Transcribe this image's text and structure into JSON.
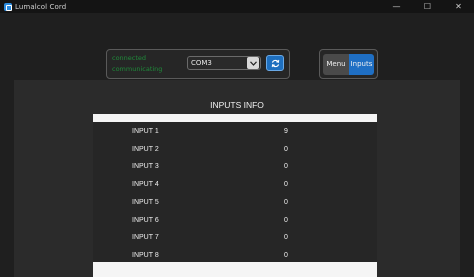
{
  "window": {
    "title": "Lumalcol Cord",
    "controls": {
      "minimize": "—",
      "maximize": "☐",
      "close": "✕"
    }
  },
  "connection": {
    "status_line_1": "connected",
    "status_line_2": "communicating",
    "port_value": "COM3",
    "dropdown_icon": "chevron-down-icon",
    "refresh_icon": "refresh-icon"
  },
  "nav": {
    "menu_label": "Menu",
    "inputs_label": "Inputs",
    "active": "Inputs"
  },
  "inputs_info": {
    "title": "INPUTS INFO",
    "rows": [
      {
        "name": "INPUT 1",
        "value": "9"
      },
      {
        "name": "INPUT 2",
        "value": "0"
      },
      {
        "name": "INPUT 3",
        "value": "0"
      },
      {
        "name": "INPUT 4",
        "value": "0"
      },
      {
        "name": "INPUT 5",
        "value": "0"
      },
      {
        "name": "INPUT 6",
        "value": "0"
      },
      {
        "name": "INPUT 7",
        "value": "0"
      },
      {
        "name": "INPUT 8",
        "value": "0"
      }
    ]
  },
  "colors": {
    "accent": "#1f6fc4",
    "status_text": "#1f8a3a",
    "background": "#1f1f1f"
  }
}
